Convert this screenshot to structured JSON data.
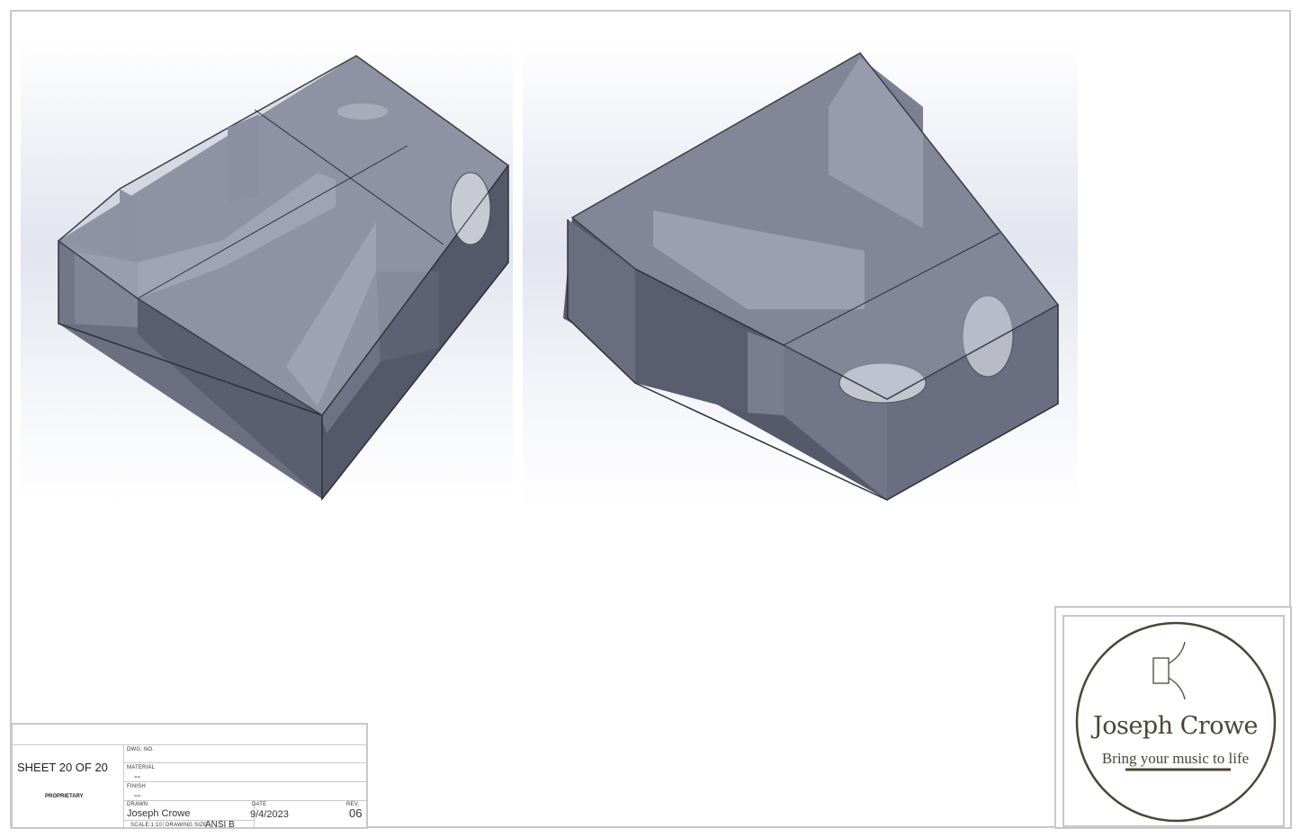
{
  "title_block": {
    "sheet": "SHEET 20 OF 20",
    "proprietary": "PROPRIETARY",
    "dwg_no_label": "DWG. NO.",
    "material_label": "MATERIAL",
    "material_value": "--",
    "finish_label": "FINISH",
    "finish_value": "--",
    "drawn_label": "DRAWN",
    "drawn_value": "Joseph Crowe",
    "date_label": "DATE",
    "date_value": "9/4/2023",
    "rev_label": "REV.",
    "rev_value": "06",
    "scale": "SCALE:1:10",
    "drawing_size_label": "DRAWING SIZE",
    "drawing_size_value": "ANSI B"
  },
  "logo": {
    "name": "Joseph Crowe",
    "tagline": "Bring your music to life",
    "icon": "speaker-icon",
    "color": "#4a4535"
  },
  "colors": {
    "border": "#c8c8c8",
    "model_face": "#6e7183",
    "model_dark": "#4f5263",
    "model_light": "#9a9cad"
  }
}
